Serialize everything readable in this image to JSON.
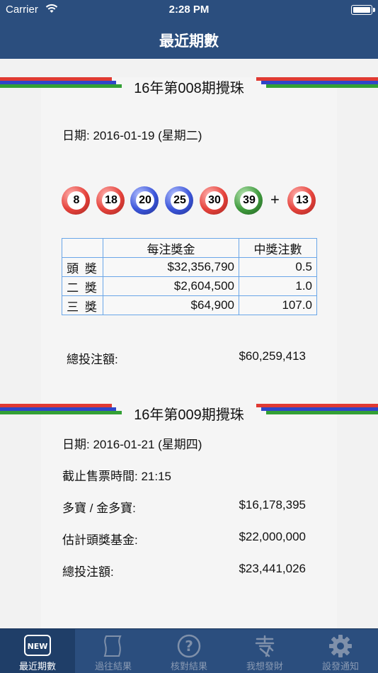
{
  "status_bar": {
    "carrier": "Carrier",
    "time": "2:28 PM"
  },
  "nav": {
    "title": "最近期數"
  },
  "draw1": {
    "title": "16年第008期攪珠",
    "date_label": "日期: 2016-01-19 (星期二)",
    "balls": [
      "8",
      "18",
      "20",
      "25",
      "30",
      "39"
    ],
    "ball_colors": [
      "#e5423b",
      "#e5423b",
      "#3b55d9",
      "#3b55d9",
      "#e5423b",
      "#3f9a3d"
    ],
    "plus": "+",
    "extra_ball": "13",
    "table": {
      "headers": [
        "",
        "每注獎金",
        "中獎注數"
      ],
      "rows": [
        {
          "level": "頭 獎",
          "prize": "$32,356,790",
          "count": "0.5"
        },
        {
          "level": "二 獎",
          "prize": "$2,604,500",
          "count": "1.0"
        },
        {
          "level": "三 獎",
          "prize": "$64,900",
          "count": "107.0"
        }
      ]
    },
    "turnover_label": "總投注額:",
    "turnover_value": "$60,259,413"
  },
  "draw2": {
    "title": "16年第009期攪珠",
    "date_label": "日期: 2016-01-21 (星期四)",
    "cutoff_label": "截止售票時間: 21:15",
    "jackpot_label": "多寶 / 金多寶:",
    "jackpot_value": "$16,178,395",
    "estimate_label": "估計頭獎基金:",
    "estimate_value": "$22,000,000",
    "turnover_label": "總投注額:",
    "turnover_value": "$23,441,026"
  },
  "tabs": [
    {
      "label": "最近期數",
      "icon": "new-icon",
      "active": true
    },
    {
      "label": "過往結果",
      "icon": "scroll-icon",
      "active": false
    },
    {
      "label": "核對結果",
      "icon": "question-icon",
      "active": false
    },
    {
      "label": "我想發財",
      "icon": "fa-character-icon",
      "active": false
    },
    {
      "label": "設發通知",
      "icon": "gear-icon",
      "active": false
    }
  ],
  "colors": {
    "nav_bg": "#2b4e7e",
    "stripe_red": "#e03a33",
    "stripe_blue": "#2f46c9",
    "stripe_green": "#33a035",
    "table_border": "#6aa6e8"
  }
}
